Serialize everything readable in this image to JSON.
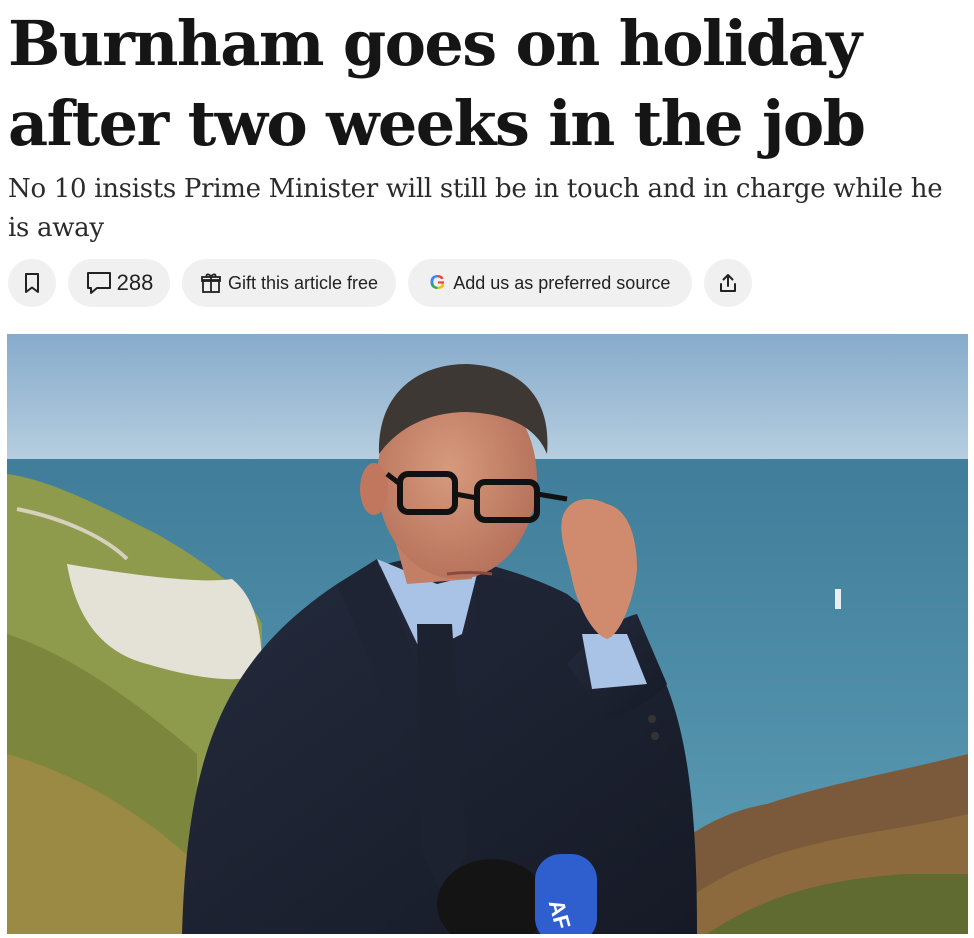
{
  "article": {
    "headline": "Burnham goes on holiday after two weeks in the job",
    "standfirst": "No 10 insists Prime Minister will still be in touch and in charge while he is away"
  },
  "toolbar": {
    "bookmark_icon": "bookmark-icon",
    "comments_icon": "comment-bubble-icon",
    "comment_count": "288",
    "gift_icon": "gift-icon",
    "gift_label": "Gift this article free",
    "google_icon": "google-g-icon",
    "source_label": "Add us as preferred source",
    "share_icon": "share-upload-icon"
  },
  "colors": {
    "pill_background": "#f0f0f0",
    "text": "#151515"
  },
  "photo": {
    "mic_label": "AF"
  }
}
